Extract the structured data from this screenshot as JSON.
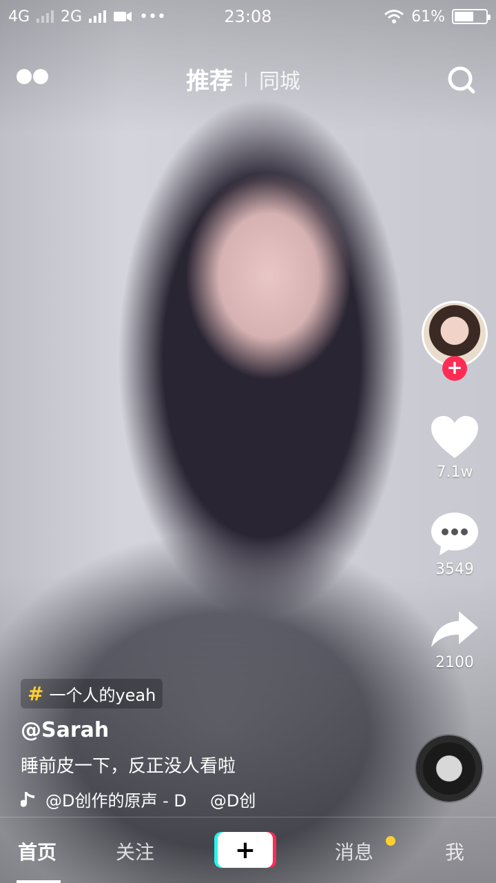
{
  "status_bar": {
    "net1": "4G",
    "net2": "2G",
    "dots": "•••",
    "time": "23:08",
    "battery_percent_text": "61%",
    "battery_level": 0.61
  },
  "top_nav": {
    "tab_main": "推荐",
    "tab_secondary": "同城"
  },
  "right_rail": {
    "likes": "7.1w",
    "comments": "3549",
    "shares": "2100",
    "follow_symbol": "+"
  },
  "info": {
    "hashtag": "一个人的yeah",
    "hash_symbol": "#",
    "username": "@Sarah",
    "caption": "睡前皮一下，反正没人看啦",
    "music_a": "@D创作的原声 - D",
    "music_b": "@D创"
  },
  "bottom_bar": {
    "home": "首页",
    "follow": "关注",
    "plus": "+",
    "messages": "消息",
    "me": "我"
  },
  "colors": {
    "accent_red": "#fe2c55",
    "accent_cyan": "#25f4ee",
    "notif_yellow": "#ffd02f"
  },
  "icons": [
    "video-camera-icon",
    "wifi-icon",
    "battery-icon",
    "live-dots-icon",
    "search-icon",
    "heart-icon",
    "comment-icon",
    "share-icon",
    "music-note-icon",
    "disc-icon"
  ]
}
